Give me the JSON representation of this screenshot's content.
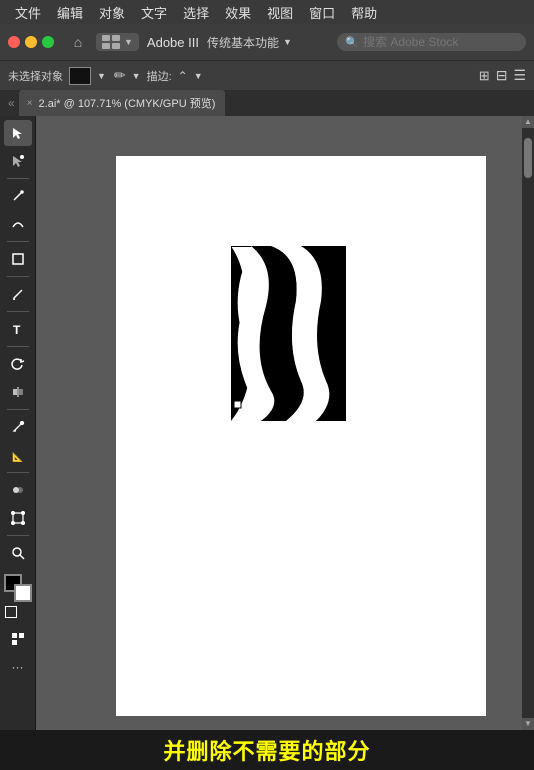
{
  "menubar": {
    "items": [
      "文件",
      "编辑",
      "对象",
      "文字",
      "选择",
      "效果",
      "视图",
      "窗口",
      "帮助"
    ]
  },
  "toolbar_top": {
    "traffic_lights": [
      "red",
      "yellow",
      "green"
    ],
    "workspace_label": "Adobe III",
    "preset_label": "传统基本功能",
    "search_placeholder": "搜索 Adobe Stock"
  },
  "toolbar_second": {
    "obj_label": "未选择对象",
    "stroke_label": "描边:",
    "stroke_value": ""
  },
  "tabbar": {
    "tab_label": "2.ai* @ 107.71% (CMYK/GPU 预览)",
    "tab_close": "×"
  },
  "canvas": {
    "background_color": "#5a5a5a"
  },
  "subtitle": {
    "text": "并删除不需要的部分"
  }
}
